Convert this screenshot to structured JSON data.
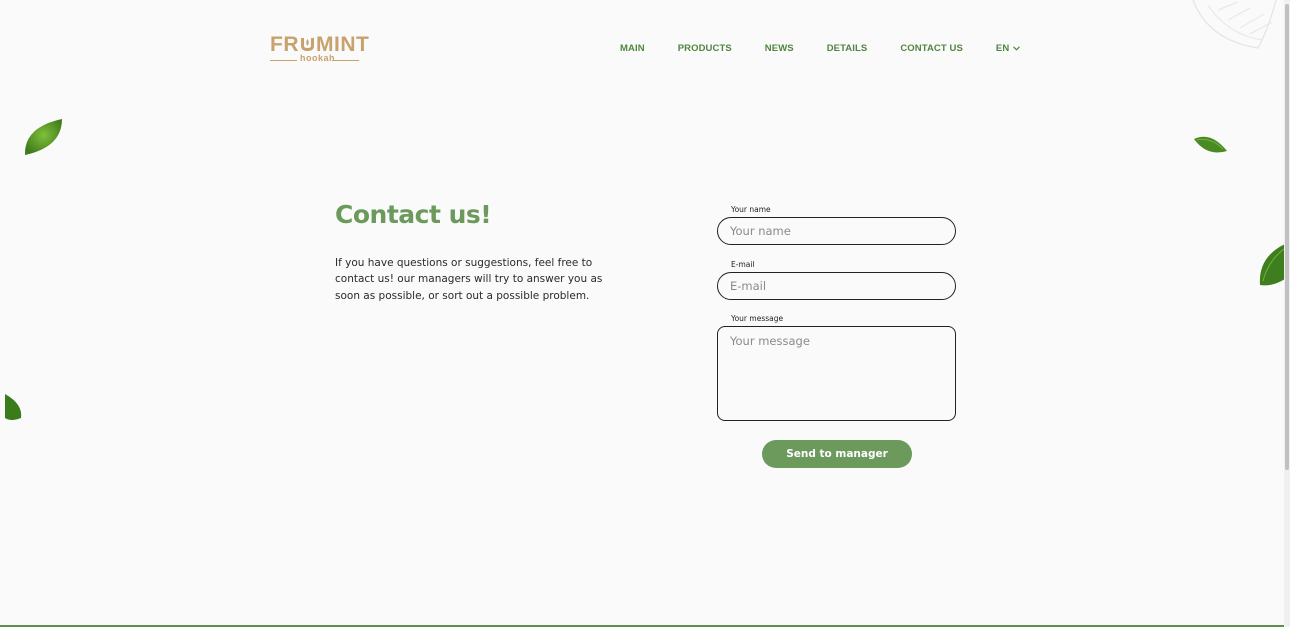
{
  "brand": {
    "logo_text_1": "FR",
    "logo_text_2": "MINT",
    "logo_sub": "hookah"
  },
  "nav": {
    "items": [
      "MAIN",
      "PRODUCTS",
      "NEWS",
      "DETAILS",
      "CONTACT US"
    ],
    "lang": "EN"
  },
  "contact": {
    "title": "Contact us!",
    "description": "If you have questions or suggestions, feel free to contact us! our managers will try to answer you as soon as possible, or sort out a possible problem."
  },
  "form": {
    "name_label": "Your name",
    "name_placeholder": "Your name",
    "email_label": "E-mail",
    "email_placeholder": "E-mail",
    "message_label": "Your message",
    "message_placeholder": "Your message",
    "submit_label": "Send to manager"
  },
  "colors": {
    "accent": "#6b9a5c",
    "nav": "#4f8640",
    "logo": "#c8a26c",
    "background": "#fafafa"
  },
  "icons": [
    "chevron-down-icon",
    "mint-leaf-icon"
  ]
}
